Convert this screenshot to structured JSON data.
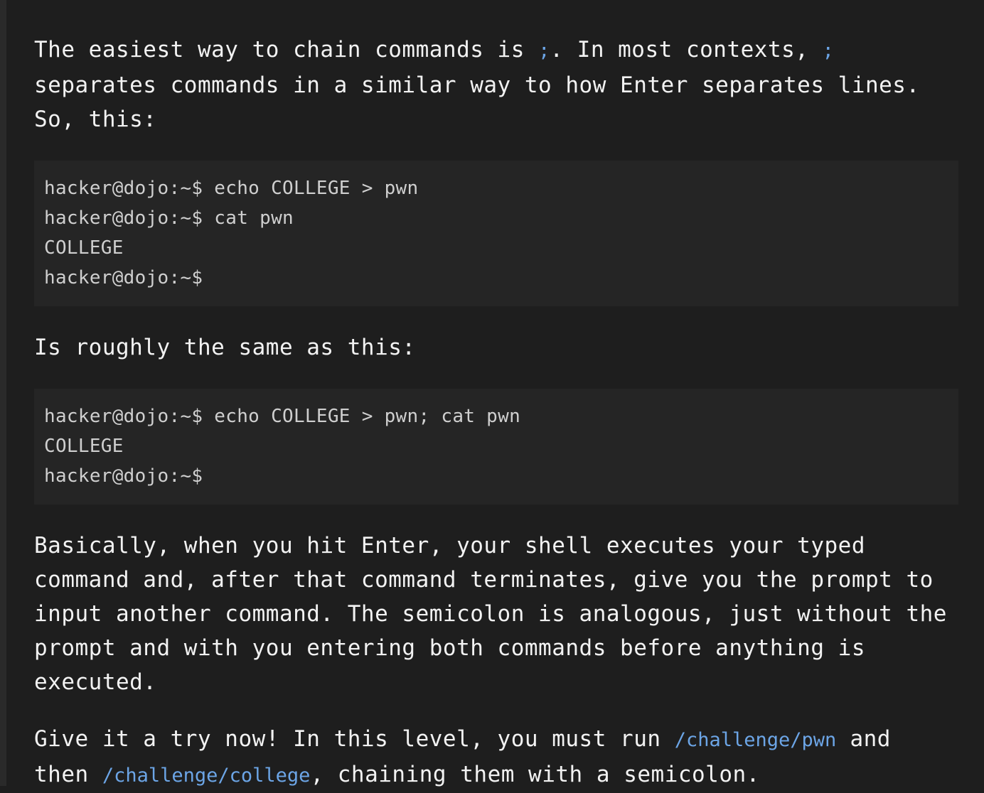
{
  "paragraphs": {
    "intro": {
      "part1": "The easiest way to chain commands is ",
      "code1": ";",
      "part2": ". In most contexts, ",
      "code2": ";",
      "part3": " separates commands in a similar way to how Enter separates lines. So, this:"
    },
    "roughly_same": "Is roughly the same as this:",
    "basically": "Basically, when you hit Enter, your shell executes your typed command and, after that command terminates, give you the prompt to input another command. The semicolon is analogous, just without the prompt and with you entering both commands before anything is executed.",
    "try_now": {
      "part1": "Give it a try now! In this level, you must run ",
      "code1": "/challenge/pwn",
      "part2": " and then ",
      "code2": "/challenge/college",
      "part3": ", chaining them with a semicolon."
    }
  },
  "code_blocks": {
    "first": [
      "hacker@dojo:~$ echo COLLEGE > pwn",
      "hacker@dojo:~$ cat pwn",
      "COLLEGE",
      "hacker@dojo:~$"
    ],
    "second": [
      "hacker@dojo:~$ echo COLLEGE > pwn; cat pwn",
      "COLLEGE",
      "hacker@dojo:~$"
    ]
  },
  "colors": {
    "background": "#1e1e1e",
    "code_block_background": "#252525",
    "inline_code": "#6ca5e6",
    "text": "#f2f2f2"
  }
}
